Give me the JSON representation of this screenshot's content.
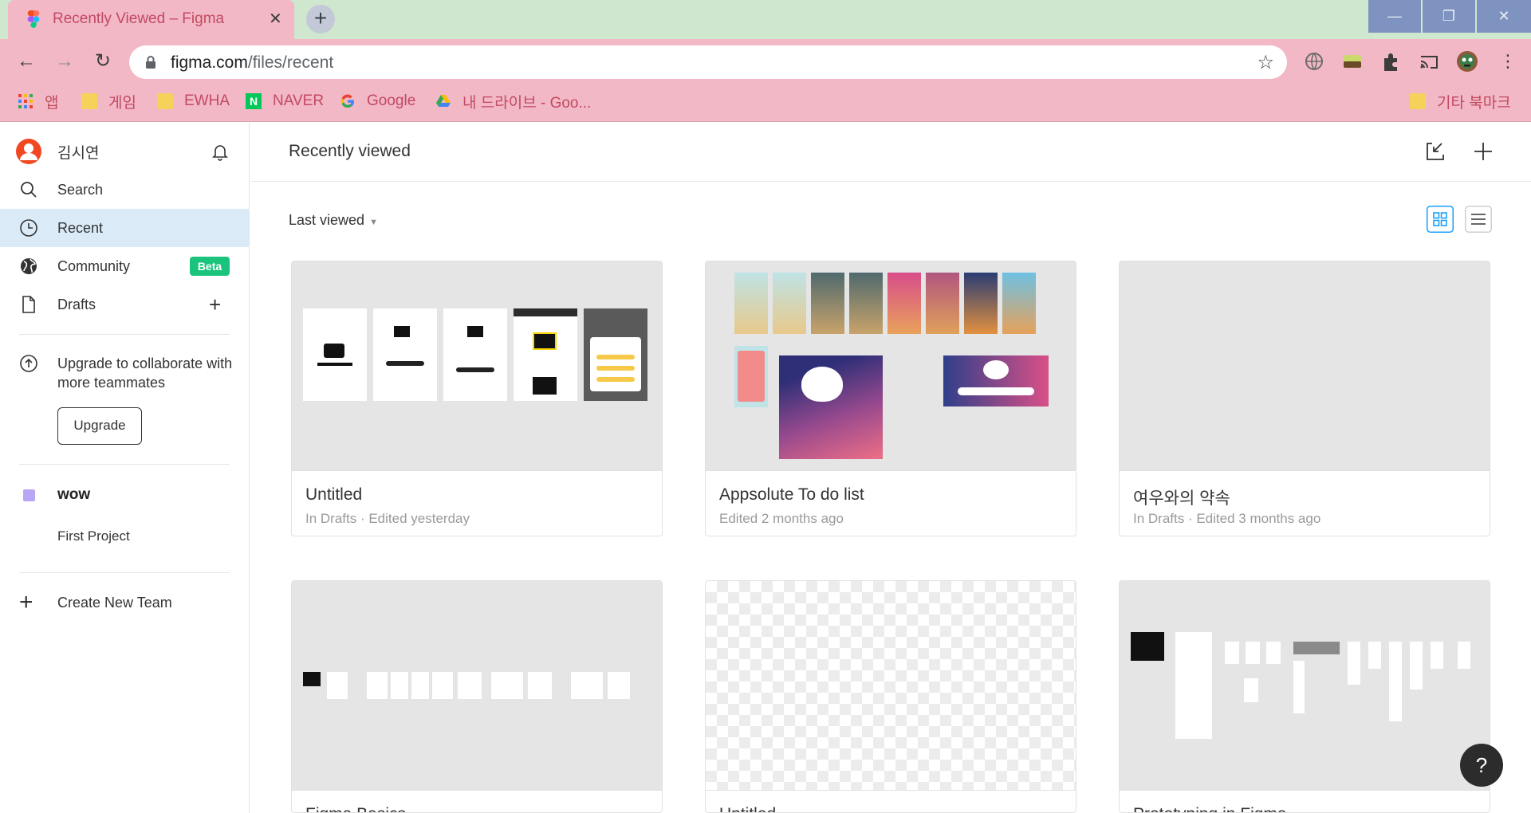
{
  "browser": {
    "tab_title": "Recently Viewed – Figma",
    "tab_close": "✕",
    "new_tab": "+",
    "url_host": "figma.com",
    "url_path": "/files/recent",
    "window_controls": [
      "—",
      "❐",
      "✕"
    ],
    "bookmarks": [
      {
        "label": "앱",
        "icon": "apps-grid-icon"
      },
      {
        "label": "게임",
        "icon": "folder-icon"
      },
      {
        "label": "EWHA",
        "icon": "folder-icon"
      },
      {
        "label": "NAVER",
        "icon": "naver-icon"
      },
      {
        "label": "Google",
        "icon": "google-icon"
      },
      {
        "label": "내 드라이브 - Goo...",
        "icon": "google-drive-icon"
      },
      {
        "label": "기타 북마크",
        "icon": "folder-icon"
      }
    ]
  },
  "sidebar": {
    "user_name": "김시연",
    "items": [
      {
        "label": "Search",
        "icon": "search-icon"
      },
      {
        "label": "Recent",
        "icon": "clock-icon",
        "active": true
      },
      {
        "label": "Community",
        "icon": "globe-icon",
        "badge": "Beta"
      },
      {
        "label": "Drafts",
        "icon": "file-icon"
      }
    ],
    "upgrade_text": "Upgrade to collaborate with more teammates",
    "upgrade_button": "Upgrade",
    "team_name": "wow",
    "team_color": "#b9a7f5",
    "project_name": "First Project",
    "create_team": "Create New Team"
  },
  "main": {
    "title": "Recently viewed",
    "sort_label": "Last viewed",
    "files": [
      {
        "name": "Untitled",
        "meta": "In Drafts · Edited yesterday"
      },
      {
        "name": "Appsolute To do list",
        "meta": "Edited 2 months ago"
      },
      {
        "name": "여우와의 약속",
        "meta": "In Drafts · Edited 3 months ago"
      },
      {
        "name": "Figma Basics",
        "meta": ""
      },
      {
        "name": "Untitled",
        "meta": ""
      },
      {
        "name": "Prototyping in Figma",
        "meta": ""
      }
    ]
  },
  "help_label": "?",
  "colors": {
    "tab_bg": "#f2b8c5",
    "tabstrip_bg": "#cfe6cf",
    "active_nav": "#daeaf7",
    "beta_badge": "#1bc47d",
    "view_active": "#18a0fb"
  }
}
